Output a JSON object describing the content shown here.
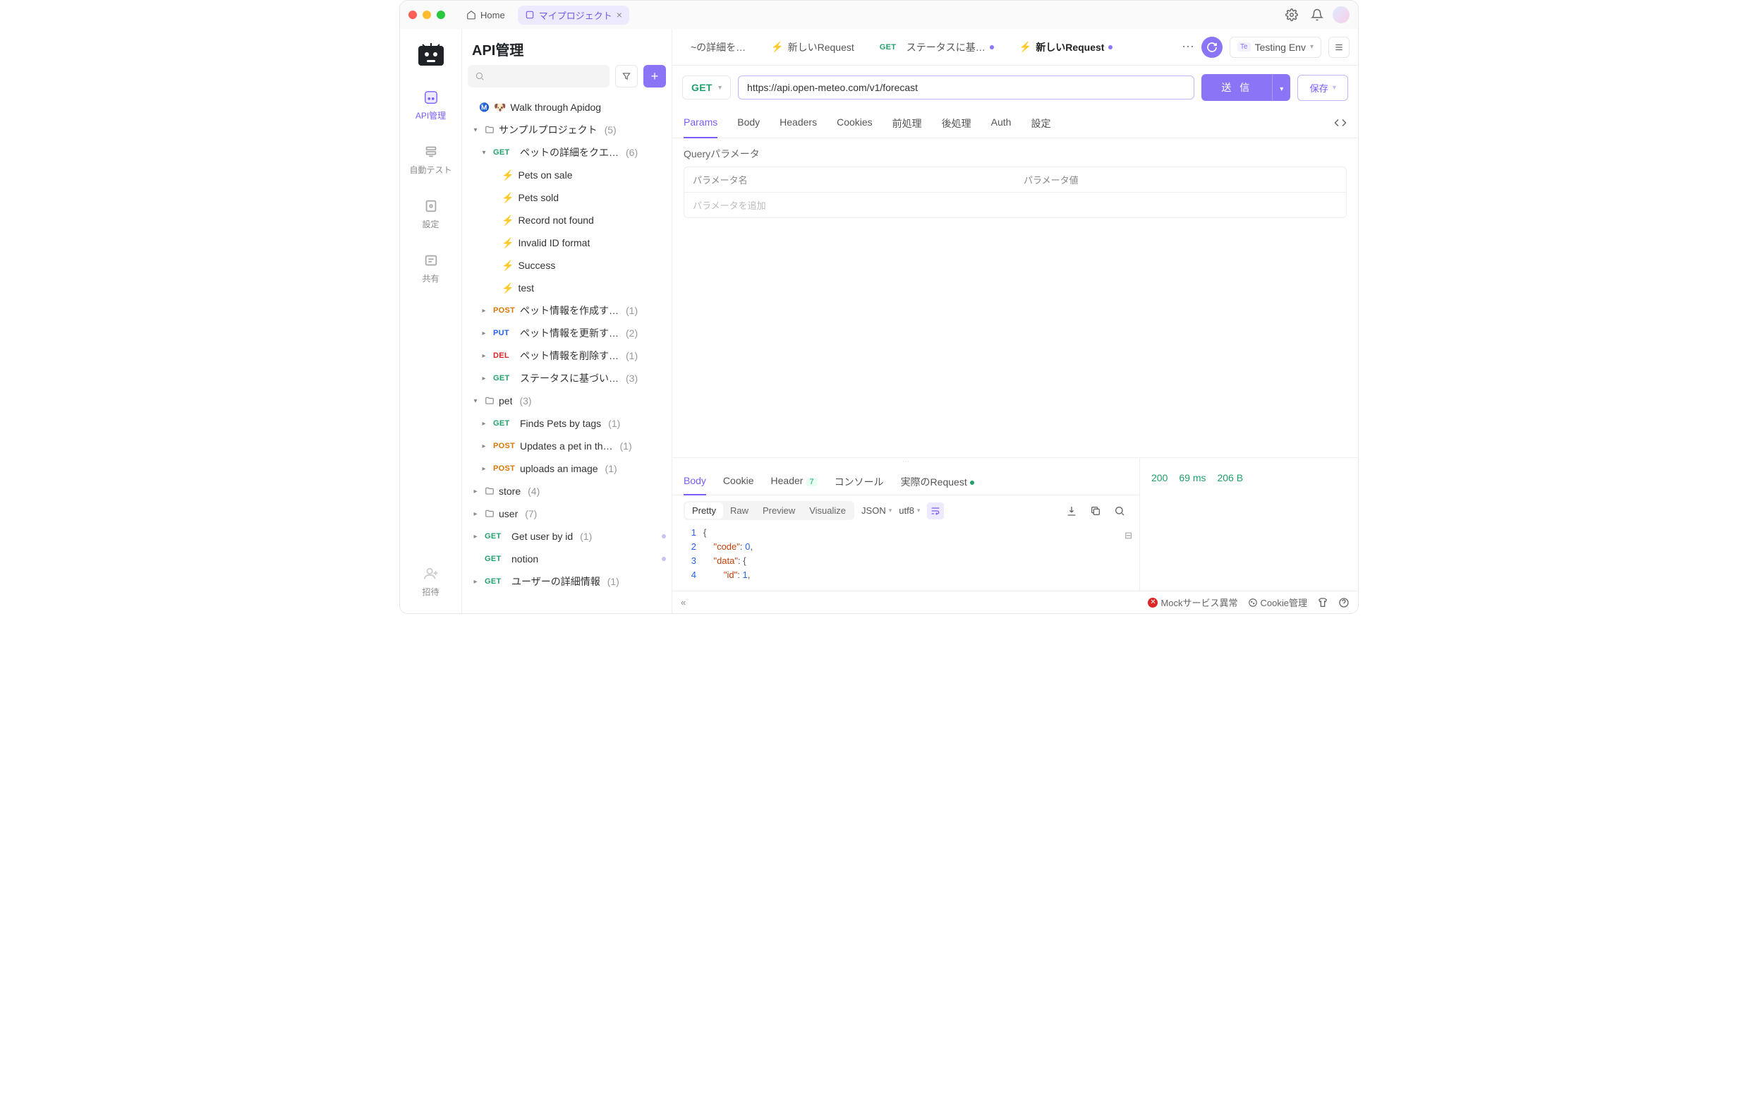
{
  "titlebar": {
    "home_label": "Home",
    "project_tab": "マイプロジェクト"
  },
  "rail": {
    "items": [
      {
        "label": "API管理"
      },
      {
        "label": "自動テスト"
      },
      {
        "label": "設定"
      },
      {
        "label": "共有"
      },
      {
        "label": "招待"
      }
    ]
  },
  "sidebar": {
    "title": "API管理",
    "walk_label": "Walk through Apidog",
    "sample_folder": "サンプルプロジェクト",
    "sample_count": "(5)",
    "pet_query": "ペットの詳細をクエ…",
    "pet_query_count": "(6)",
    "cases": [
      "Pets on sale",
      "Pets sold",
      "Record not found",
      "Invalid ID format",
      "Success",
      "test"
    ],
    "post_pet": "ペット情報を作成す…",
    "post_pet_c": "(1)",
    "put_pet": "ペット情報を更新す…",
    "put_pet_c": "(2)",
    "del_pet": "ペット情報を削除す…",
    "del_pet_c": "(1)",
    "get_status": "ステータスに基づい…",
    "get_status_c": "(3)",
    "pet_folder": "pet",
    "pet_folder_c": "(3)",
    "finds_tags": "Finds Pets by tags",
    "finds_tags_c": "(1)",
    "updates": "Updates a pet in th…",
    "updates_c": "(1)",
    "uploads": "uploads an image",
    "uploads_c": "(1)",
    "store": "store",
    "store_c": "(4)",
    "user": "user",
    "user_c": "(7)",
    "get_user": "Get user by id",
    "get_user_c": "(1)",
    "notion": "notion",
    "user_detail": "ユーザーの詳細情報",
    "user_detail_c": "(1)"
  },
  "m": {
    "get": "GET",
    "post": "POST",
    "put": "PUT",
    "del": "DEL"
  },
  "main_tabs": {
    "t1": "~の詳細を…",
    "t2": "新しいRequest",
    "t3": "ステータスに基…",
    "t4": "新しいRequest"
  },
  "env": {
    "te": "Te",
    "name": "Testing Env"
  },
  "request": {
    "method": "GET",
    "url": "https://api.open-meteo.com/v1/forecast",
    "send": "送 信",
    "save": "保存"
  },
  "req_tabs": [
    "Params",
    "Body",
    "Headers",
    "Cookies",
    "前処理",
    "後処理",
    "Auth",
    "設定"
  ],
  "params": {
    "title": "Queryパラメータ",
    "col_name": "パラメータ名",
    "col_value": "パラメータ値",
    "placeholder": "パラメータを追加"
  },
  "resp_tabs": {
    "body": "Body",
    "cookie": "Cookie",
    "header": "Header",
    "header_n": "7",
    "console": "コンソール",
    "actual": "実際のRequest"
  },
  "view_modes": [
    "Pretty",
    "Raw",
    "Preview",
    "Visualize"
  ],
  "fmt_json": "JSON",
  "fmt_enc": "utf8",
  "status": {
    "code": "200",
    "time": "69 ms",
    "size": "206 B"
  },
  "code_lines": [
    "{",
    "  \"code\": 0,",
    "  \"data\": {",
    "    \"id\": 1,"
  ],
  "footer": {
    "mock_err": "Mockサービス異常",
    "cookie": "Cookie管理"
  }
}
